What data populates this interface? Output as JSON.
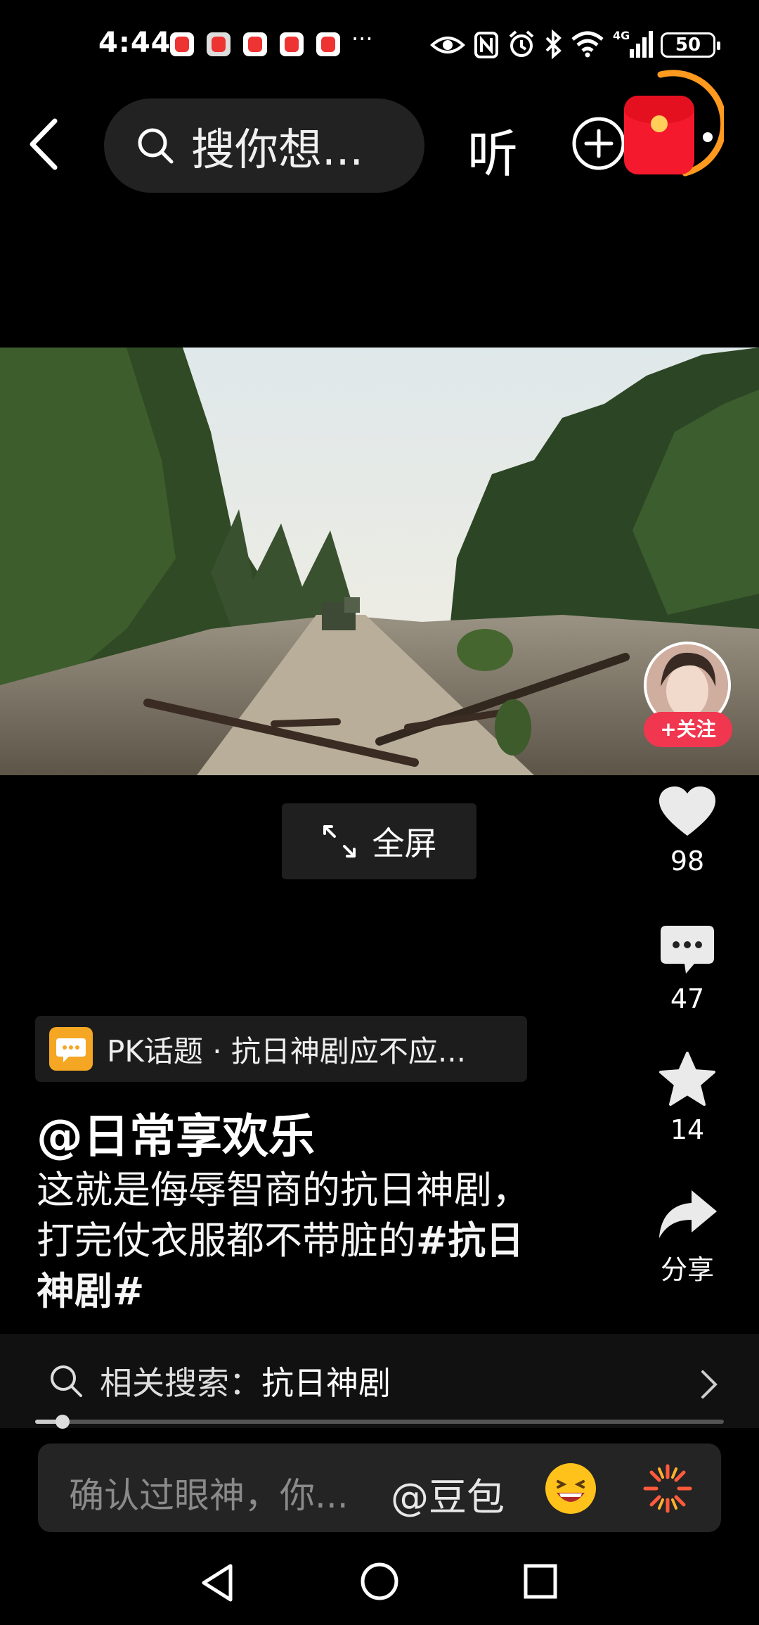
{
  "status_bar": {
    "time": "4:44",
    "more_notifications": "···",
    "battery": "50"
  },
  "top_nav": {
    "search_placeholder": "搜你想...",
    "listen_label": "听"
  },
  "creator": {
    "follow_label": "+关注"
  },
  "fullscreen_label": "全屏",
  "actions": {
    "likes": "98",
    "comments": "47",
    "favorites": "14",
    "share_label": "分享"
  },
  "topic": {
    "text": "PK话题 · 抗日神剧应不应..."
  },
  "post": {
    "author": "@日常享欢乐",
    "caption_text": "这就是侮辱智商的抗日神剧，打完仗衣服都不带脏的",
    "caption_tag": "#抗日神剧#"
  },
  "related_search": {
    "label": "相关搜索：",
    "term": "抗日神剧"
  },
  "playback": {
    "progress_fraction": 0.04
  },
  "comment_bar": {
    "placeholder": "确认过眼神，你...",
    "mention": "@豆包"
  },
  "colors": {
    "follow_button": "#f0374f",
    "redpacket": "#f5192e",
    "timer_ring": "#ff9a1f",
    "topic_icon": "#f5a623"
  }
}
